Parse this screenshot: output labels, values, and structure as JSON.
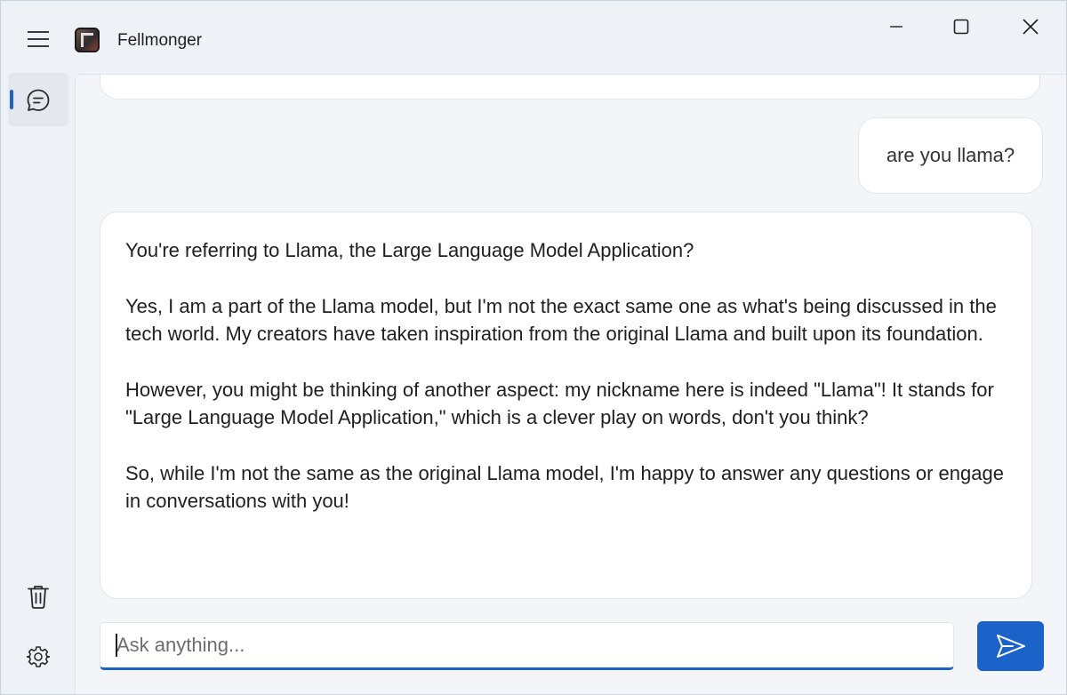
{
  "app": {
    "title": "Fellmonger"
  },
  "conversation": {
    "user_message": "are you llama?",
    "assistant_paragraphs": [
      "You're referring to Llama, the Large Language Model Application?",
      "Yes, I am a part of the Llama model, but I'm not the exact same one as what's being discussed in the tech world. My creators have taken inspiration from the original Llama and built upon its foundation.",
      "However, you might be thinking of another aspect: my nickname here is indeed \"Llama\"! It stands for \"Large Language Model Application,\" which is a clever play on words, don't you think?",
      "So, while I'm not the same as the original Llama model, I'm happy to answer any questions or engage in conversations with you!"
    ]
  },
  "input": {
    "placeholder": "Ask anything...",
    "value": ""
  },
  "icons": {
    "menu": "hamburger-menu-icon",
    "logo": "fellmonger-app-logo",
    "minimize": "minimize-icon",
    "maximize": "maximize-icon",
    "close": "close-icon",
    "chat": "chat-bubble-icon",
    "trash": "trash-icon",
    "settings": "gear-icon",
    "send": "send-icon"
  },
  "colors": {
    "accent": "#1b63c8",
    "window_background": "#eef1f6",
    "content_background": "#f3f5f9",
    "bubble_background": "#ffffff"
  }
}
